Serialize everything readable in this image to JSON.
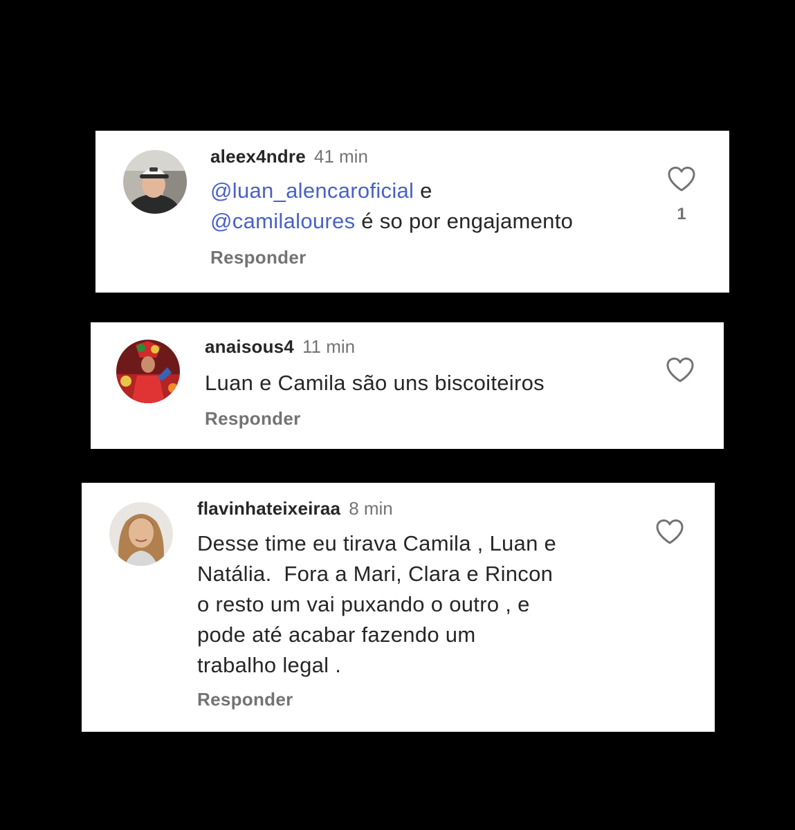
{
  "comments": [
    {
      "username": "aleex4ndre",
      "time": "41 min",
      "line1_mention": "@luan_alencaroficial",
      "line1_text": " e",
      "line2_mention": "@camilaloures",
      "line2_text": " é so por engajamento",
      "reply_label": "Responder",
      "likes": "1"
    },
    {
      "username": "anaisous4",
      "time": "11 min",
      "text": "Luan e Camila são uns biscoiteiros",
      "reply_label": "Responder"
    },
    {
      "username": "flavinhateixeiraa",
      "time": "8 min",
      "lines": [
        "Desse time eu tirava Camila , Luan e",
        "Natália.  Fora a Mari, Clara e Rincon",
        "o resto um vai puxando o outro , e",
        "pode até acabar fazendo um",
        "trabalho legal ."
      ],
      "reply_label": "Responder"
    }
  ],
  "colors": {
    "background": "#000000",
    "card": "#ffffff",
    "text": "#262626",
    "secondary": "#737373",
    "mention": "#4861c9"
  },
  "icons": {
    "like": "heart-outline-icon"
  }
}
